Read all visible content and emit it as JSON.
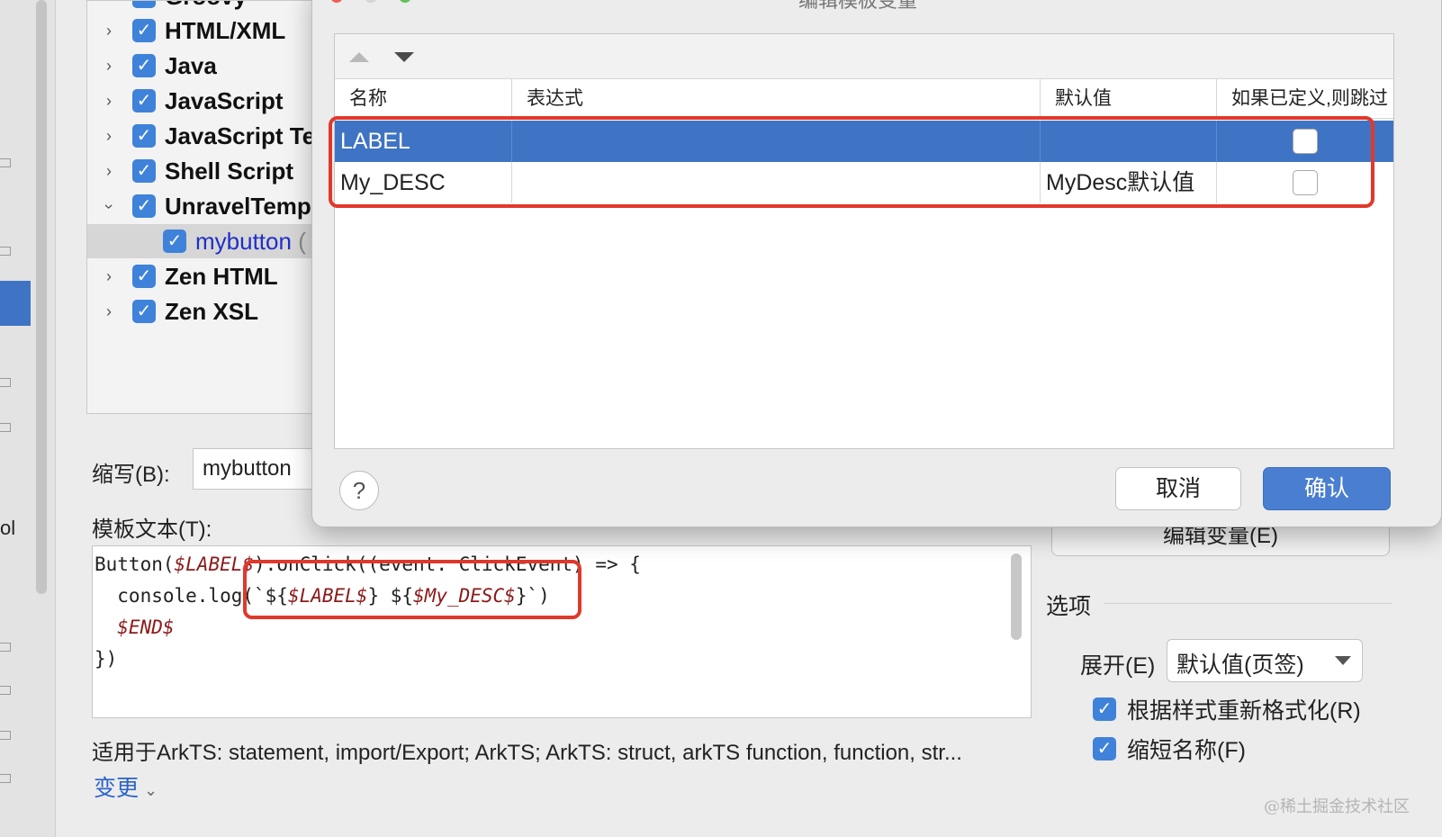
{
  "tree": {
    "items": [
      {
        "label": "Groovy",
        "expanded": false
      },
      {
        "label": "HTML/XML",
        "expanded": false
      },
      {
        "label": "Java",
        "expanded": false
      },
      {
        "label": "JavaScript",
        "expanded": false
      },
      {
        "label": "JavaScript Te",
        "expanded": false
      },
      {
        "label": "Shell Script",
        "expanded": false
      },
      {
        "label": "UnravelTempl",
        "expanded": true
      },
      {
        "label": "mybutton",
        "suffix": "(",
        "child": true
      },
      {
        "label": "Zen HTML",
        "expanded": false
      },
      {
        "label": "Zen XSL",
        "expanded": false
      }
    ]
  },
  "left_strip": {
    "partial_text": "ol"
  },
  "abbreviation": {
    "label": "缩写(B):",
    "value": "mybutton"
  },
  "template_text": {
    "label": "模板文本(T):",
    "lines": [
      {
        "pre": "Button(",
        "var1": "$LABEL$",
        "post": ").onClick((event: ClickEvent) => {"
      },
      {
        "pre": "  console.log(`${",
        "var1": "$LABEL$",
        "mid": "} ${",
        "var2": "$My_DESC$",
        "post": "}`)"
      },
      {
        "var1": "  $END$"
      },
      {
        "pre": "})"
      }
    ]
  },
  "applies_to": "适用于ArkTS: statement, import/Export; ArkTS; ArkTS: struct, arkTS function, function, str...",
  "change_link": "变更",
  "edit_variables_button": "编辑变量(E)",
  "options": {
    "title": "选项",
    "expand_label": "展开(E)",
    "expand_value": "默认值(页签)",
    "reformat": {
      "label": "根据样式重新格式化(R)",
      "checked": true
    },
    "shorten": {
      "label": "缩短名称(F)",
      "checked": true
    }
  },
  "dialog": {
    "title": "编辑模板变量",
    "columns": [
      "名称",
      "表达式",
      "默认值",
      "如果已定义,则跳过"
    ],
    "rows": [
      {
        "name": "LABEL",
        "expression": "",
        "default": "",
        "skip": false,
        "selected": true
      },
      {
        "name": "My_DESC",
        "expression": "",
        "default": "MyDesc默认值",
        "skip": false,
        "selected": false
      }
    ],
    "help": "?",
    "cancel": "取消",
    "ok": "确认"
  },
  "watermark": "@稀土掘金技术社区",
  "colors": {
    "accent": "#3f74c4",
    "highlight": "#e0392b",
    "checkbox": "#3f82d9"
  }
}
